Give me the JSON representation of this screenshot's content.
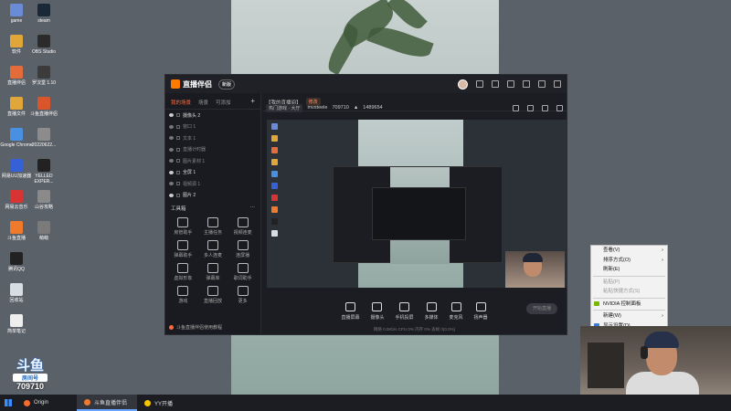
{
  "desktop": {
    "icons": [
      {
        "label": "game",
        "color": "#6a8bd6"
      },
      {
        "label": "steam",
        "color": "#1b2838"
      },
      {
        "label": "软件",
        "color": "#e0a63a"
      },
      {
        "label": "OBS Studio",
        "color": "#2b2b2b"
      },
      {
        "label": "直播伴侣",
        "color": "#e46b3a"
      },
      {
        "label": "罗汉堂 1.10",
        "color": "#3b3b3b"
      },
      {
        "label": "直播文件",
        "color": "#e0a63a"
      },
      {
        "label": "斗鱼直播伴侣",
        "color": "#d9552b"
      },
      {
        "label": "Google Chrome",
        "color": "#4a90e2"
      },
      {
        "label": "20220622...",
        "color": "#8c8c8c"
      },
      {
        "label": "网易UU加速器",
        "color": "#3560d6"
      },
      {
        "label": "YELLED EXPER...",
        "color": "#222"
      },
      {
        "label": "网易云音乐",
        "color": "#d93434"
      },
      {
        "label": "山谷攻略",
        "color": "#8a8a8a"
      },
      {
        "label": "斗鱼直播",
        "color": "#f07a2b"
      },
      {
        "label": "萌萌",
        "color": "#7a7a7a"
      },
      {
        "label": "腾讯QQ",
        "color": "#222"
      },
      {
        "label": "回收站",
        "color": "#d6dde3"
      },
      {
        "label": "简单笔记",
        "color": "#eeeeee"
      }
    ]
  },
  "app": {
    "name": "直播伴侣",
    "version_badge": "新版",
    "left_tabs": [
      "我的场景",
      "场景",
      "可添加"
    ],
    "scenes": [
      {
        "label": "摄像头 2",
        "on": true
      },
      {
        "label": "窗口 1",
        "on": false
      },
      {
        "label": "文本 1",
        "on": false
      },
      {
        "label": "直播计时器",
        "on": false
      },
      {
        "label": "图片素材 1",
        "on": false
      },
      {
        "label": "全屏 1",
        "on": true
      },
      {
        "label": "视频源 1",
        "on": false
      },
      {
        "label": "图片 2",
        "on": true
      }
    ],
    "tools_header": "工具箱",
    "tools": [
      "房管助手",
      "主播任务",
      "视频连麦",
      "弹幕助手",
      "多人连麦",
      "连屏播",
      "虚拟形象",
      "弹幕库",
      "歌词助手",
      "游戏",
      "直播回放",
      "更多"
    ],
    "footer_text": "斗鱼直播伴侣使用教程",
    "room_title": "【我的直播间】",
    "room_tag": "修改",
    "category": "热门游戏 · 大厅",
    "streamer_name": "mvsteele",
    "room_id": "709710",
    "viewers": "1489654",
    "bottom_controls": [
      "直播屏幕",
      "摄像头",
      "手机投屏",
      "多媒体",
      "麦克风",
      "扬声器"
    ],
    "go_live": "开始直播",
    "status_text": "网络 0.0Kb/s   CPU 0%   内存 0%   丢帧 0(0.0%)"
  },
  "context_menu": {
    "items": [
      {
        "label": "查看(V)",
        "has_sub": true,
        "disabled": false
      },
      {
        "label": "排序方式(O)",
        "has_sub": true,
        "disabled": false
      },
      {
        "label": "刷新(E)",
        "has_sub": false,
        "disabled": false
      },
      {
        "label": "粘贴(P)",
        "has_sub": false,
        "disabled": true
      },
      {
        "label": "粘贴快捷方式(S)",
        "has_sub": false,
        "disabled": true
      },
      {
        "label": "NVIDIA 控制面板",
        "has_sub": false,
        "disabled": false
      },
      {
        "label": "新建(W)",
        "has_sub": true,
        "disabled": false
      },
      {
        "label": "显示设置(D)",
        "has_sub": false,
        "disabled": false
      }
    ]
  },
  "overlay": {
    "platform_text": "斗鱼",
    "room_label": "房间号",
    "room_number": "709710"
  },
  "taskbar": {
    "apps": [
      {
        "label": "Origin",
        "color": "#f56c2d",
        "active": false
      },
      {
        "label": "斗鱼直播伴侣",
        "color": "#f07a2b",
        "active": true
      },
      {
        "label": "YY开播",
        "color": "#f5c400",
        "active": false
      }
    ]
  }
}
